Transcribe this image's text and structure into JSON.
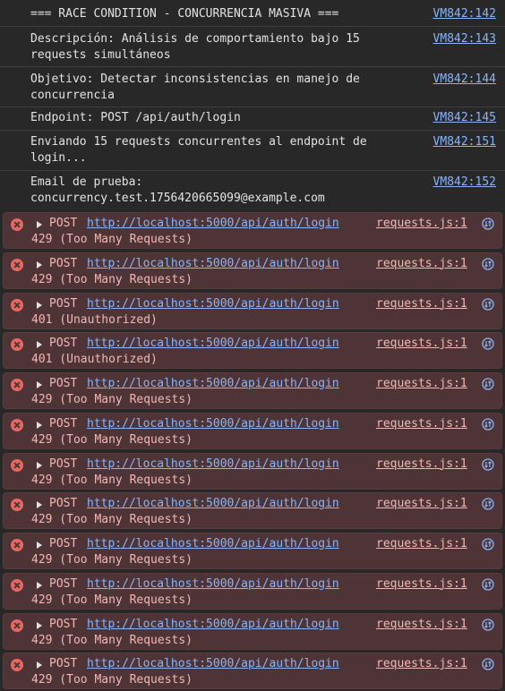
{
  "logs": [
    {
      "text": "=== RACE CONDITION - CONCURRENCIA MASIVA ===",
      "source": "VM842:142"
    },
    {
      "text": "Descripción: Análisis de comportamiento bajo 15 requests simultáneos",
      "source": "VM842:143"
    },
    {
      "text": "Objetivo: Detectar inconsistencias en manejo de concurrencia",
      "source": "VM842:144"
    },
    {
      "text": "Endpoint: POST /api/auth/login",
      "source": "VM842:145"
    },
    {
      "text": "Enviando 15 requests concurrentes al endpoint de login...",
      "source": "VM842:151"
    },
    {
      "text": "Email de prueba: concurrency.test.1756420665099@example.com",
      "source": "VM842:152"
    }
  ],
  "errors": [
    {
      "method": "POST",
      "url": "http://localhost:5000/api/auth/login",
      "status": "429 (Too Many Requests)",
      "source": "requests.js:1"
    },
    {
      "method": "POST",
      "url": "http://localhost:5000/api/auth/login",
      "status": "429 (Too Many Requests)",
      "source": "requests.js:1"
    },
    {
      "method": "POST",
      "url": "http://localhost:5000/api/auth/login",
      "status": "401 (Unauthorized)",
      "source": "requests.js:1"
    },
    {
      "method": "POST",
      "url": "http://localhost:5000/api/auth/login",
      "status": "401 (Unauthorized)",
      "source": "requests.js:1"
    },
    {
      "method": "POST",
      "url": "http://localhost:5000/api/auth/login",
      "status": "429 (Too Many Requests)",
      "source": "requests.js:1"
    },
    {
      "method": "POST",
      "url": "http://localhost:5000/api/auth/login",
      "status": "429 (Too Many Requests)",
      "source": "requests.js:1"
    },
    {
      "method": "POST",
      "url": "http://localhost:5000/api/auth/login",
      "status": "429 (Too Many Requests)",
      "source": "requests.js:1"
    },
    {
      "method": "POST",
      "url": "http://localhost:5000/api/auth/login",
      "status": "429 (Too Many Requests)",
      "source": "requests.js:1"
    },
    {
      "method": "POST",
      "url": "http://localhost:5000/api/auth/login",
      "status": "429 (Too Many Requests)",
      "source": "requests.js:1"
    },
    {
      "method": "POST",
      "url": "http://localhost:5000/api/auth/login",
      "status": "429 (Too Many Requests)",
      "source": "requests.js:1"
    },
    {
      "method": "POST",
      "url": "http://localhost:5000/api/auth/login",
      "status": "429 (Too Many Requests)",
      "source": "requests.js:1"
    },
    {
      "method": "POST",
      "url": "http://localhost:5000/api/auth/login",
      "status": "429 (Too Many Requests)",
      "source": "requests.js:1"
    }
  ],
  "icons": {
    "error": "error-icon",
    "expand": "expand-triangle-icon",
    "network": "network-request-icon"
  },
  "colors": {
    "error_bg": "#4e3436",
    "link": "#8ab4f8",
    "error_text": "#f2b8b5"
  }
}
